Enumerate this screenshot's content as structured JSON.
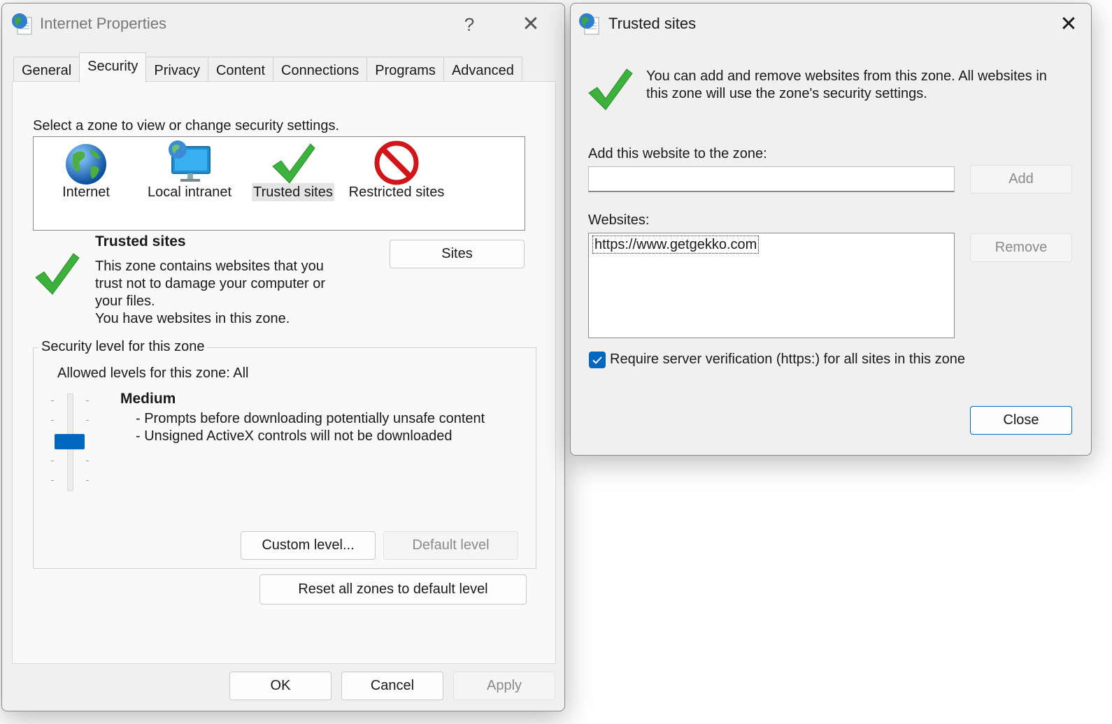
{
  "internet_properties": {
    "title": "Internet Properties",
    "help_glyph": "?",
    "close_glyph": "✕",
    "tabs": [
      {
        "label": "General"
      },
      {
        "label": "Security"
      },
      {
        "label": "Privacy"
      },
      {
        "label": "Content"
      },
      {
        "label": "Connections"
      },
      {
        "label": "Programs"
      },
      {
        "label": "Advanced"
      }
    ],
    "active_tab": "Security",
    "zone_prompt": "Select a zone to view or change security settings.",
    "zones": [
      {
        "label": "Internet",
        "icon": "globe-icon"
      },
      {
        "label": "Local intranet",
        "icon": "intranet-monitor-icon"
      },
      {
        "label": "Trusted sites",
        "icon": "green-checkmark-icon"
      },
      {
        "label": "Restricted sites",
        "icon": "restricted-no-icon"
      }
    ],
    "selected_zone": "Trusted sites",
    "zone_info": {
      "heading": "Trusted sites",
      "desc_lines": [
        "This zone contains websites that you",
        "trust not to damage your computer or",
        "your files."
      ],
      "note": "You have websites in this zone."
    },
    "sites_button": "Sites",
    "security_level": {
      "legend": "Security level for this zone",
      "allowed": "Allowed levels for this zone: All",
      "level_name": "Medium",
      "bullets": [
        "- Prompts before downloading potentially unsafe content",
        "- Unsigned ActiveX controls will not be downloaded"
      ],
      "slider_position_index": 2,
      "slider_positions": 5
    },
    "custom_level_button": "Custom level...",
    "default_level_button": "Default level",
    "reset_all_button": "Reset all zones to default level",
    "ok_button": "OK",
    "cancel_button": "Cancel",
    "apply_button": "Apply"
  },
  "trusted_sites_dialog": {
    "title": "Trusted sites",
    "close_glyph": "✕",
    "info_lines": [
      "You can add and remove websites from this zone. All websites in",
      "this zone will use the zone's security settings."
    ],
    "add_label": "Add this website to the zone:",
    "add_input_value": "",
    "add_button": "Add",
    "websites_label": "Websites:",
    "websites": [
      "https://www.getgekko.com"
    ],
    "remove_button": "Remove",
    "require_https_label": "Require server verification (https:) for all sites in this zone",
    "require_https_checked": true,
    "close_button": "Close"
  },
  "colors": {
    "accent": "#0067c0",
    "window_bg": "#f0f0f0",
    "panel_bg": "#f9f9f9"
  }
}
